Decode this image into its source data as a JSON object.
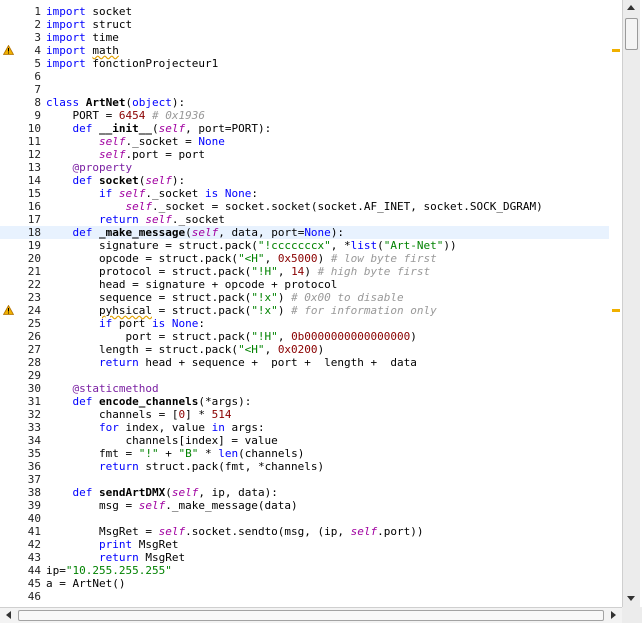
{
  "editor": {
    "language": "python",
    "current_line": 18,
    "warning_lines": [
      4,
      24
    ],
    "lines": [
      {
        "n": "1",
        "t": [
          [
            "keyword",
            "import"
          ],
          [
            "plain",
            " socket"
          ]
        ]
      },
      {
        "n": "2",
        "t": [
          [
            "keyword",
            "import"
          ],
          [
            "plain",
            " struct"
          ]
        ]
      },
      {
        "n": "3",
        "t": [
          [
            "keyword",
            "import"
          ],
          [
            "plain",
            " time"
          ]
        ]
      },
      {
        "n": "4",
        "t": [
          [
            "keyword",
            "import"
          ],
          [
            "plain",
            " "
          ],
          [
            "squiggle",
            "math"
          ]
        ]
      },
      {
        "n": "5",
        "t": [
          [
            "keyword",
            "import"
          ],
          [
            "plain",
            " fonctionProjecteur1"
          ]
        ]
      },
      {
        "n": "6",
        "t": []
      },
      {
        "n": "7",
        "t": []
      },
      {
        "n": "8",
        "t": [
          [
            "keyword",
            "class"
          ],
          [
            "plain",
            " "
          ],
          [
            "def",
            "ArtNet"
          ],
          [
            "plain",
            "("
          ],
          [
            "keyword",
            "object"
          ],
          [
            "plain",
            "):"
          ]
        ]
      },
      {
        "n": "9",
        "t": [
          [
            "plain",
            "    PORT = "
          ],
          [
            "number",
            "6454"
          ],
          [
            "plain",
            " "
          ],
          [
            "comment",
            "# 0x1936"
          ]
        ]
      },
      {
        "n": "10",
        "t": [
          [
            "plain",
            "    "
          ],
          [
            "keyword",
            "def"
          ],
          [
            "plain",
            " "
          ],
          [
            "def",
            "__init__"
          ],
          [
            "plain",
            "("
          ],
          [
            "self",
            "self"
          ],
          [
            "plain",
            ", port=PORT):"
          ]
        ]
      },
      {
        "n": "11",
        "t": [
          [
            "plain",
            "        "
          ],
          [
            "self",
            "self"
          ],
          [
            "plain",
            "._socket = "
          ],
          [
            "keyword",
            "None"
          ]
        ]
      },
      {
        "n": "12",
        "t": [
          [
            "plain",
            "        "
          ],
          [
            "self",
            "self"
          ],
          [
            "plain",
            ".port = port"
          ]
        ]
      },
      {
        "n": "13",
        "t": [
          [
            "plain",
            "    "
          ],
          [
            "decorator",
            "@property"
          ]
        ]
      },
      {
        "n": "14",
        "t": [
          [
            "plain",
            "    "
          ],
          [
            "keyword",
            "def"
          ],
          [
            "plain",
            " "
          ],
          [
            "def",
            "socket"
          ],
          [
            "plain",
            "("
          ],
          [
            "self",
            "self"
          ],
          [
            "plain",
            "):"
          ]
        ]
      },
      {
        "n": "15",
        "t": [
          [
            "plain",
            "        "
          ],
          [
            "keyword",
            "if"
          ],
          [
            "plain",
            " "
          ],
          [
            "self",
            "self"
          ],
          [
            "plain",
            "._socket "
          ],
          [
            "keyword",
            "is"
          ],
          [
            "plain",
            " "
          ],
          [
            "keyword",
            "None"
          ],
          [
            "plain",
            ":"
          ]
        ]
      },
      {
        "n": "16",
        "t": [
          [
            "plain",
            "            "
          ],
          [
            "self",
            "self"
          ],
          [
            "plain",
            "._socket = socket.socket(socket.AF_INET, socket.SOCK_DGRAM)"
          ]
        ]
      },
      {
        "n": "17",
        "t": [
          [
            "plain",
            "        "
          ],
          [
            "keyword",
            "return"
          ],
          [
            "plain",
            " "
          ],
          [
            "self",
            "self"
          ],
          [
            "plain",
            "._socket"
          ]
        ]
      },
      {
        "n": "18",
        "t": [
          [
            "plain",
            "    "
          ],
          [
            "keyword",
            "def"
          ],
          [
            "plain",
            " "
          ],
          [
            "def",
            "_make_message"
          ],
          [
            "plain",
            "("
          ],
          [
            "self",
            "self"
          ],
          [
            "plain",
            ", data, port="
          ],
          [
            "keyword",
            "None"
          ],
          [
            "plain",
            "):"
          ]
        ]
      },
      {
        "n": "19",
        "t": [
          [
            "plain",
            "        signature = struct.pack("
          ],
          [
            "string",
            "\"!cccccccx\""
          ],
          [
            "plain",
            ", *"
          ],
          [
            "keyword",
            "list"
          ],
          [
            "plain",
            "("
          ],
          [
            "string",
            "\"Art-Net\""
          ],
          [
            "plain",
            "))"
          ]
        ]
      },
      {
        "n": "20",
        "t": [
          [
            "plain",
            "        opcode = struct.pack("
          ],
          [
            "string",
            "\"<H\""
          ],
          [
            "plain",
            ", "
          ],
          [
            "number",
            "0x5000"
          ],
          [
            "plain",
            ") "
          ],
          [
            "comment",
            "# low byte first"
          ]
        ]
      },
      {
        "n": "21",
        "t": [
          [
            "plain",
            "        protocol = struct.pack("
          ],
          [
            "string",
            "\"!H\""
          ],
          [
            "plain",
            ", "
          ],
          [
            "number",
            "14"
          ],
          [
            "plain",
            ") "
          ],
          [
            "comment",
            "# high byte first"
          ]
        ]
      },
      {
        "n": "22",
        "t": [
          [
            "plain",
            "        head = signature + opcode + protocol"
          ]
        ]
      },
      {
        "n": "23",
        "t": [
          [
            "plain",
            "        sequence = struct.pack("
          ],
          [
            "string",
            "\"!x\""
          ],
          [
            "plain",
            ") "
          ],
          [
            "comment",
            "# 0x00 to disable"
          ]
        ]
      },
      {
        "n": "24",
        "t": [
          [
            "plain",
            "        "
          ],
          [
            "squiggle",
            "pyhsical"
          ],
          [
            "plain",
            " = struct.pack("
          ],
          [
            "string",
            "\"!x\""
          ],
          [
            "plain",
            ") "
          ],
          [
            "comment",
            "# for information only"
          ]
        ]
      },
      {
        "n": "25",
        "t": [
          [
            "plain",
            "        "
          ],
          [
            "keyword",
            "if"
          ],
          [
            "plain",
            " port "
          ],
          [
            "keyword",
            "is"
          ],
          [
            "plain",
            " "
          ],
          [
            "keyword",
            "None"
          ],
          [
            "plain",
            ":"
          ]
        ]
      },
      {
        "n": "26",
        "t": [
          [
            "plain",
            "            port = struct.pack("
          ],
          [
            "string",
            "\"!H\""
          ],
          [
            "plain",
            ", "
          ],
          [
            "number",
            "0b0000000000000000"
          ],
          [
            "plain",
            ")"
          ]
        ]
      },
      {
        "n": "27",
        "t": [
          [
            "plain",
            "        length = struct.pack("
          ],
          [
            "string",
            "\"<H\""
          ],
          [
            "plain",
            ", "
          ],
          [
            "number",
            "0x0200"
          ],
          [
            "plain",
            ")"
          ]
        ]
      },
      {
        "n": "28",
        "t": [
          [
            "plain",
            "        "
          ],
          [
            "keyword",
            "return"
          ],
          [
            "plain",
            " head + sequence +  port +  length +  data"
          ]
        ]
      },
      {
        "n": "29",
        "t": []
      },
      {
        "n": "30",
        "t": [
          [
            "plain",
            "    "
          ],
          [
            "decorator",
            "@staticmethod"
          ]
        ]
      },
      {
        "n": "31",
        "t": [
          [
            "plain",
            "    "
          ],
          [
            "keyword",
            "def"
          ],
          [
            "plain",
            " "
          ],
          [
            "def",
            "encode_channels"
          ],
          [
            "plain",
            "(*args):"
          ]
        ]
      },
      {
        "n": "32",
        "t": [
          [
            "plain",
            "        channels = ["
          ],
          [
            "number",
            "0"
          ],
          [
            "plain",
            "] * "
          ],
          [
            "number",
            "514"
          ]
        ]
      },
      {
        "n": "33",
        "t": [
          [
            "plain",
            "        "
          ],
          [
            "keyword",
            "for"
          ],
          [
            "plain",
            " index, value "
          ],
          [
            "keyword",
            "in"
          ],
          [
            "plain",
            " args:"
          ]
        ]
      },
      {
        "n": "34",
        "t": [
          [
            "plain",
            "            channels[index] = value"
          ]
        ]
      },
      {
        "n": "35",
        "t": [
          [
            "plain",
            "        fmt = "
          ],
          [
            "string",
            "\"!\""
          ],
          [
            "plain",
            " + "
          ],
          [
            "string",
            "\"B\""
          ],
          [
            "plain",
            " * "
          ],
          [
            "keyword",
            "len"
          ],
          [
            "plain",
            "(channels)"
          ]
        ]
      },
      {
        "n": "36",
        "t": [
          [
            "plain",
            "        "
          ],
          [
            "keyword",
            "return"
          ],
          [
            "plain",
            " struct.pack(fmt, *channels)"
          ]
        ]
      },
      {
        "n": "37",
        "t": []
      },
      {
        "n": "38",
        "t": [
          [
            "plain",
            "    "
          ],
          [
            "keyword",
            "def"
          ],
          [
            "plain",
            " "
          ],
          [
            "def",
            "sendArtDMX"
          ],
          [
            "plain",
            "("
          ],
          [
            "self",
            "self"
          ],
          [
            "plain",
            ", ip, data):"
          ]
        ]
      },
      {
        "n": "39",
        "t": [
          [
            "plain",
            "        msg = "
          ],
          [
            "self",
            "self"
          ],
          [
            "plain",
            "._make_message(data)"
          ]
        ]
      },
      {
        "n": "40",
        "t": []
      },
      {
        "n": "41",
        "t": [
          [
            "plain",
            "        MsgRet = "
          ],
          [
            "self",
            "self"
          ],
          [
            "plain",
            ".socket.sendto(msg, (ip, "
          ],
          [
            "self",
            "self"
          ],
          [
            "plain",
            ".port))"
          ]
        ]
      },
      {
        "n": "42",
        "t": [
          [
            "plain",
            "        "
          ],
          [
            "keyword",
            "print"
          ],
          [
            "plain",
            " MsgRet"
          ]
        ]
      },
      {
        "n": "43",
        "t": [
          [
            "plain",
            "        "
          ],
          [
            "keyword",
            "return"
          ],
          [
            "plain",
            " MsgRet"
          ]
        ]
      },
      {
        "n": "44",
        "t": [
          [
            "plain",
            "ip="
          ],
          [
            "string",
            "\"10.255.255.255\""
          ]
        ]
      },
      {
        "n": "45",
        "t": [
          [
            "plain",
            "a = ArtNet()"
          ]
        ]
      },
      {
        "n": "46",
        "t": []
      }
    ]
  },
  "scrollbars": {
    "vertical_position_fraction": 0.0,
    "horizontal_position_fraction": 0.0
  },
  "colors": {
    "keyword": "#0000ff",
    "string": "#008200",
    "number": "#8a0000",
    "comment": "#999999",
    "current_line_bg": "#e8f2fe",
    "warning": "#f0b000"
  }
}
